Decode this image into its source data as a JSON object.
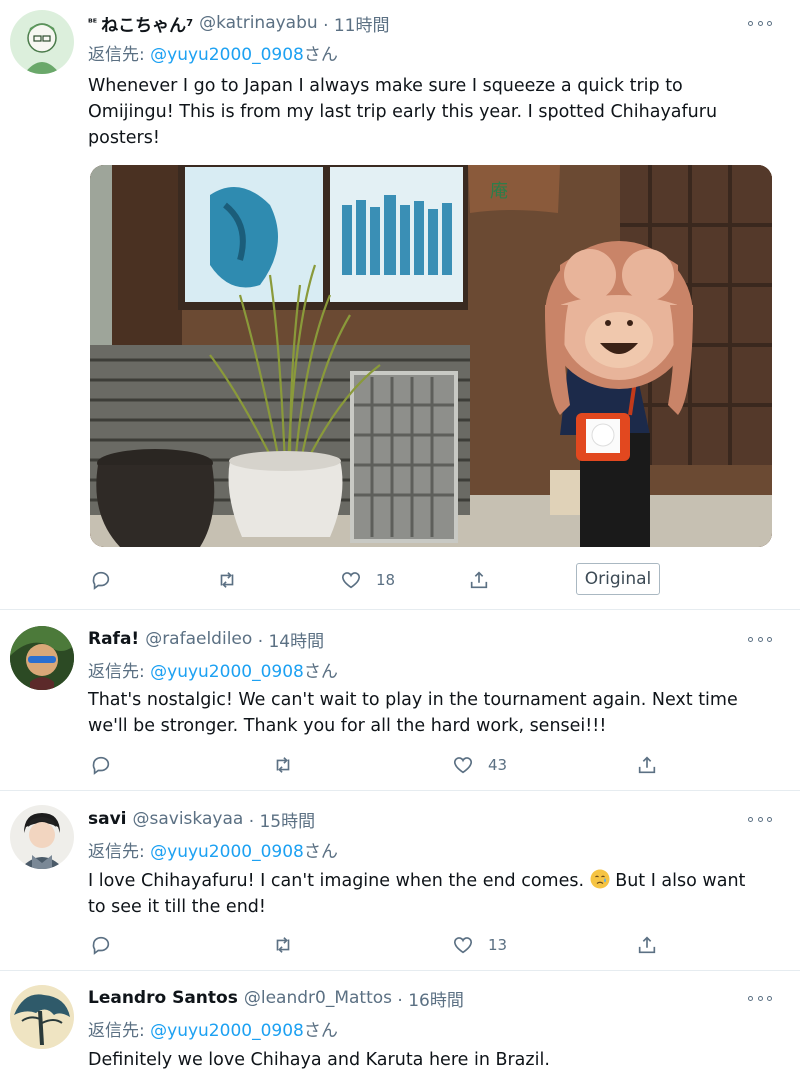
{
  "tweets": [
    {
      "name_prefix": "ᴮᴱ",
      "name": "ねこちゃん",
      "name_suffix": "7",
      "handle": "@katrinayabu",
      "time": "· 11時間",
      "reply_prefix": "返信先: ",
      "reply_mention": "@yuyu2000_0908",
      "reply_suffix": "さん",
      "text": "Whenever I go to Japan I always make sure I squeeze a quick trip to Omijingu! This is from my last trip early this year. I spotted Chihayafuru posters!",
      "likes": "18",
      "original_label": "Original"
    },
    {
      "name": "Rafa!",
      "handle": "@rafaeldileo",
      "time": "· 14時間",
      "reply_prefix": "返信先: ",
      "reply_mention": "@yuyu2000_0908",
      "reply_suffix": "さん",
      "text": "That's nostalgic! We can't wait to play in the tournament again. Next time we'll be stronger. Thank you for all the hard work, sensei!!!",
      "likes": "43"
    },
    {
      "name": "savi",
      "handle": "@saviskayaa",
      "time": "· 15時間",
      "reply_prefix": "返信先: ",
      "reply_mention": "@yuyu2000_0908",
      "reply_suffix": "さん",
      "text_before": "I love Chihayafuru! I can't imagine when the end comes.",
      "text_after": " But I also want to see it till the end!",
      "likes": "13"
    },
    {
      "name": "Leandro Santos",
      "handle": "@leandr0_Mattos",
      "time": "· 16時間",
      "reply_prefix": "返信先: ",
      "reply_mention": "@yuyu2000_0908",
      "reply_suffix": "さん",
      "text": "Definitely we love Chihaya and Karuta here in Brazil."
    }
  ],
  "icons": {
    "reply": "reply-icon",
    "retweet": "retweet-icon",
    "like": "heart-icon",
    "share": "share-icon",
    "more": "more-icon",
    "crying": "crying-face-emoji"
  },
  "colors": {
    "link": "#1da1f2",
    "secondary": "#5b7083",
    "text": "#0f1419"
  }
}
